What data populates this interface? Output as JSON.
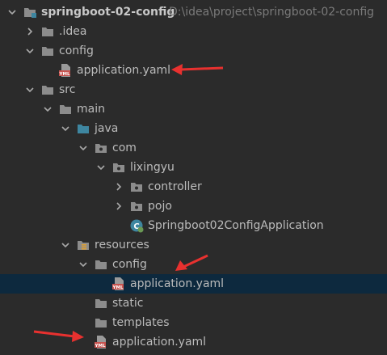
{
  "project": {
    "name": "springboot-02-config",
    "path": "D:\\idea\\project\\springboot-02-config"
  },
  "tree": [
    {
      "label": "springboot-02-config",
      "icon": "module-folder-icon",
      "depth": 0,
      "chevron": "down",
      "root": true
    },
    {
      "label": ".idea",
      "icon": "folder-icon",
      "depth": 1,
      "chevron": "right"
    },
    {
      "label": "config",
      "icon": "folder-icon",
      "depth": 1,
      "chevron": "down"
    },
    {
      "label": "application.yaml",
      "icon": "yaml-file-icon",
      "depth": 2,
      "chevron": ""
    },
    {
      "label": "src",
      "icon": "folder-icon",
      "depth": 1,
      "chevron": "down"
    },
    {
      "label": "main",
      "icon": "folder-icon",
      "depth": 2,
      "chevron": "down"
    },
    {
      "label": "java",
      "icon": "source-root-folder-icon",
      "depth": 3,
      "chevron": "down"
    },
    {
      "label": "com",
      "icon": "package-icon",
      "depth": 4,
      "chevron": "down"
    },
    {
      "label": "lixingyu",
      "icon": "package-icon",
      "depth": 5,
      "chevron": "down"
    },
    {
      "label": "controller",
      "icon": "package-icon",
      "depth": 6,
      "chevron": "right"
    },
    {
      "label": "pojo",
      "icon": "package-icon",
      "depth": 6,
      "chevron": "right"
    },
    {
      "label": "Springboot02ConfigApplication",
      "icon": "spring-boot-class-icon",
      "depth": 6,
      "chevron": ""
    },
    {
      "label": "resources",
      "icon": "resources-folder-icon",
      "depth": 3,
      "chevron": "down"
    },
    {
      "label": "config",
      "icon": "folder-icon",
      "depth": 4,
      "chevron": "down"
    },
    {
      "label": "application.yaml",
      "icon": "yaml-file-icon",
      "depth": 5,
      "chevron": "",
      "selected": true
    },
    {
      "label": "static",
      "icon": "folder-icon",
      "depth": 4,
      "chevron": ""
    },
    {
      "label": "templates",
      "icon": "folder-icon",
      "depth": 4,
      "chevron": ""
    },
    {
      "label": "application.yaml",
      "icon": "yaml-file-icon",
      "depth": 4,
      "chevron": ""
    }
  ],
  "colors": {
    "background": "#2b2b2b",
    "text": "#bbbbbb",
    "path_text": "#7a7a7a",
    "selection": "#0d293e",
    "folder": "#8c8c8c",
    "source_folder": "#3e86a0",
    "yaml_badge": "#c75450",
    "spring": "#6a9955",
    "annotation_arrow": "#e8312f"
  },
  "annotations": [
    {
      "name": "red-arrow",
      "points_to_row": 3
    },
    {
      "name": "red-arrow",
      "points_to_row": 13
    },
    {
      "name": "red-arrow",
      "points_to_row": 17
    }
  ]
}
